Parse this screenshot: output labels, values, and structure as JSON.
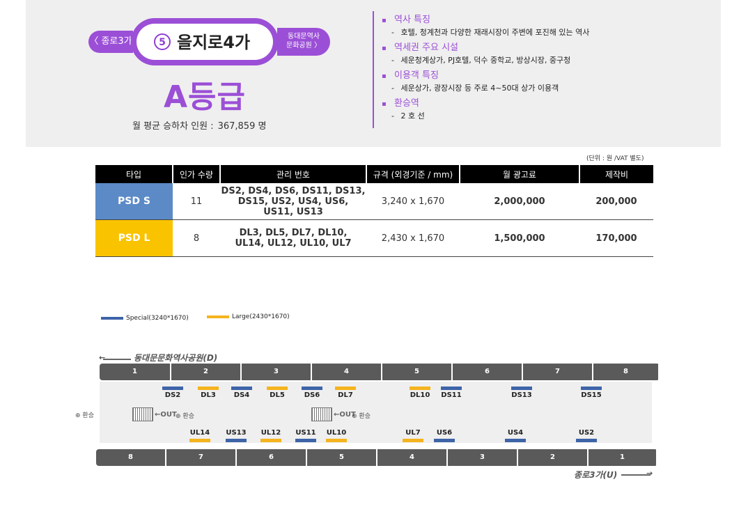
{
  "station": {
    "prev": "〈 종로3가",
    "number": "5",
    "name": "을지로4가",
    "next_line1": "동대문역사",
    "next_line2": "문화공원 〉",
    "grade": "A등급",
    "ridership_label": "월 평균 승하차 인원 :",
    "ridership_value": "367,859 명"
  },
  "info": [
    {
      "title": "역사 특징",
      "desc": "호텔, 청계천과 다양한 재래시장이 주변에 포진해 있는 역사"
    },
    {
      "title": "역세권 주요 시설",
      "desc": "세운청계상가, PJ호텔, 덕수 중학교, 방상시장, 중구청"
    },
    {
      "title": "이용객 특징",
      "desc": "세운상가, 광장시장 등 주로 4~50대 상가 이용객"
    },
    {
      "title": "환승역",
      "desc": "2 호 선"
    }
  ],
  "table": {
    "unit_note": "(단위 : 원 /VAT 별도)",
    "headers": [
      "타입",
      "인가 수량",
      "관리 번호",
      "규격 (외경기준 / mm)",
      "월 광고료",
      "제작비"
    ],
    "rows": [
      {
        "type": "PSD S",
        "count": "11",
        "ids_line1": "DS2, DS4, DS6, DS11, DS13,",
        "ids_line2": "DS15, US2, US4, US6,",
        "ids_line3": "US11, US13",
        "size": "3,240 x 1,670",
        "price": "2,000,000",
        "production": "200,000",
        "color": "#5b8ac7"
      },
      {
        "type": "PSD L",
        "count": "8",
        "ids_line1": "DL3, DL5, DL7, DL10,",
        "ids_line2": "UL14, UL12, UL10, UL7",
        "ids_line3": "",
        "size": "2,430 x 1,670",
        "price": "1,500,000",
        "production": "170,000",
        "color": "#f9c300"
      }
    ]
  },
  "legend": {
    "special": "Special(3240*1670)",
    "large": "Large(2430*1670)",
    "special_color": "#3e64a8",
    "large_color": "#f5b41e"
  },
  "map": {
    "top_direction": "동대문문화역사공원(D)",
    "bottom_direction": "종로3가(U)",
    "transfer": "환승",
    "out": "OUT",
    "top_doors": [
      "1",
      "2",
      "3",
      "4",
      "5",
      "6",
      "7",
      "8"
    ],
    "bottom_doors": [
      "8",
      "7",
      "6",
      "5",
      "4",
      "3",
      "2",
      "1"
    ],
    "top_marks": [
      "DS2",
      "DL3",
      "DS4",
      "DL5",
      "DS6",
      "DL7",
      "DL10",
      "DS11",
      "DS13",
      "DS15"
    ],
    "bottom_marks": [
      "UL14",
      "US13",
      "UL12",
      "US11",
      "UL10",
      "UL7",
      "US6",
      "US4",
      "US2"
    ]
  }
}
